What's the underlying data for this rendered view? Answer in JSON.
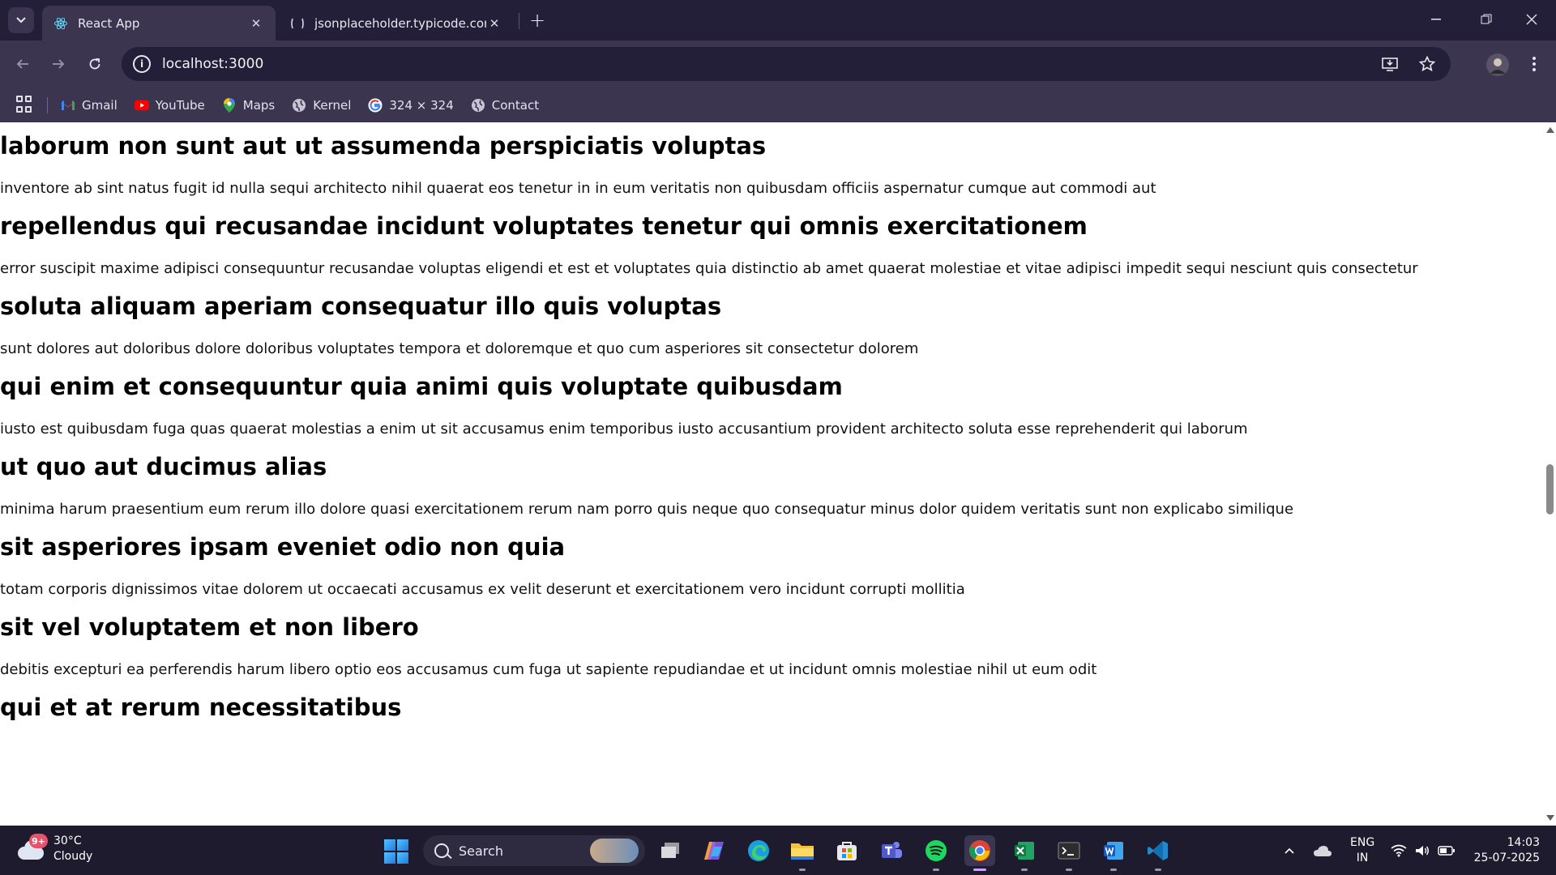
{
  "browser": {
    "tabs": [
      {
        "title": "React App",
        "active": true
      },
      {
        "title": "jsonplaceholder.typicode.com/p",
        "active": false
      }
    ],
    "url": "localhost:3000",
    "bookmarks": [
      {
        "label": "Gmail",
        "icon": "gmail-icon"
      },
      {
        "label": "YouTube",
        "icon": "youtube-icon"
      },
      {
        "label": "Maps",
        "icon": "maps-icon"
      },
      {
        "label": "Kernel",
        "icon": "globe-icon"
      },
      {
        "label": "324 × 324",
        "icon": "google-icon"
      },
      {
        "label": "Contact",
        "icon": "globe-icon"
      }
    ]
  },
  "posts": [
    {
      "title": "laborum non sunt aut ut assumenda perspiciatis voluptas",
      "body": "inventore ab sint natus fugit id nulla sequi architecto nihil quaerat eos tenetur in in eum veritatis non quibusdam officiis aspernatur cumque aut commodi aut"
    },
    {
      "title": "repellendus qui recusandae incidunt voluptates tenetur qui omnis exercitationem",
      "body": "error suscipit maxime adipisci consequuntur recusandae voluptas eligendi et est et voluptates quia distinctio ab amet quaerat molestiae et vitae adipisci impedit sequi nesciunt quis consectetur"
    },
    {
      "title": "soluta aliquam aperiam consequatur illo quis voluptas",
      "body": "sunt dolores aut doloribus dolore doloribus voluptates tempora et doloremque et quo cum asperiores sit consectetur dolorem"
    },
    {
      "title": "qui enim et consequuntur quia animi quis voluptate quibusdam",
      "body": "iusto est quibusdam fuga quas quaerat molestias a enim ut sit accusamus enim temporibus iusto accusantium provident architecto soluta esse reprehenderit qui laborum"
    },
    {
      "title": "ut quo aut ducimus alias",
      "body": "minima harum praesentium eum rerum illo dolore quasi exercitationem rerum nam porro quis neque quo consequatur minus dolor quidem veritatis sunt non explicabo similique"
    },
    {
      "title": "sit asperiores ipsam eveniet odio non quia",
      "body": "totam corporis dignissimos vitae dolorem ut occaecati accusamus ex velit deserunt et exercitationem vero incidunt corrupti mollitia"
    },
    {
      "title": "sit vel voluptatem et non libero",
      "body": "debitis excepturi ea perferendis harum libero optio eos accusamus cum fuga ut sapiente repudiandae et ut incidunt omnis molestiae nihil ut eum odit"
    },
    {
      "title": "qui et at rerum necessitatibus",
      "body": ""
    }
  ],
  "taskbar": {
    "weather": {
      "temp": "30°C",
      "condition": "Cloudy",
      "badge": "9+"
    },
    "search_placeholder": "Search",
    "apps": [
      "task-view",
      "copilot",
      "edge",
      "file-explorer",
      "microsoft-store",
      "teams",
      "spotify",
      "chrome",
      "excel",
      "terminal",
      "word",
      "vscode"
    ],
    "tray": {
      "lang_line1": "ENG",
      "lang_line2": "IN",
      "time": "14:03",
      "date": "25-07-2025"
    }
  },
  "colors": {
    "accent": "#3b3550",
    "tabstrip": "#241f38",
    "taskbar": "#1e1b2e"
  }
}
